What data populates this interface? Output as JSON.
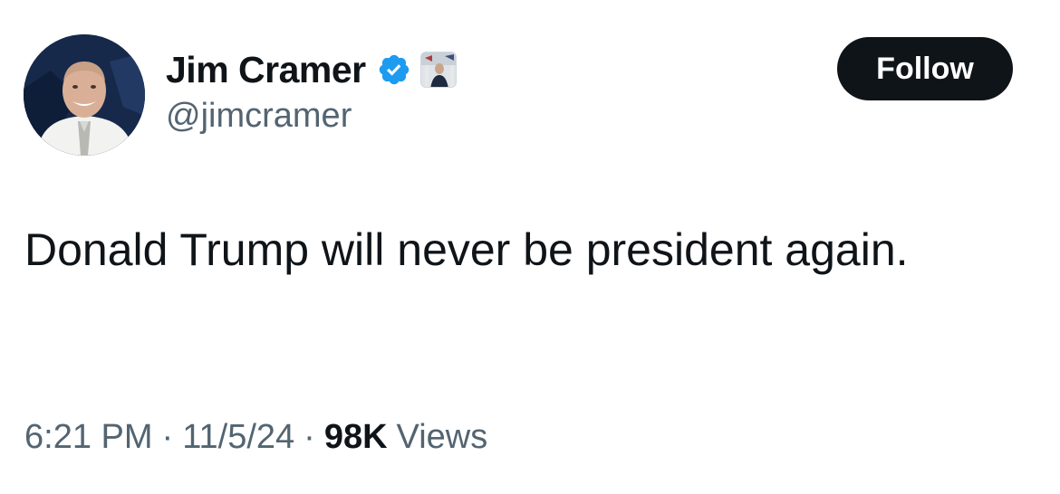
{
  "author": {
    "display_name": "Jim Cramer",
    "handle": "@jimcramer",
    "verified_icon": "verified-checkmark-icon",
    "affiliate_badge": "affiliate-badge"
  },
  "follow_button": {
    "label": "Follow"
  },
  "tweet": {
    "text": "Donald Trump will never be president again."
  },
  "meta": {
    "time": "6:21 PM",
    "separator": "·",
    "date": "11/5/24",
    "views_count": "98K",
    "views_label": "Views"
  },
  "colors": {
    "text_primary": "#0f1419",
    "text_secondary": "#536471",
    "verified_blue": "#1d9bf0",
    "button_bg": "#0f1419"
  }
}
